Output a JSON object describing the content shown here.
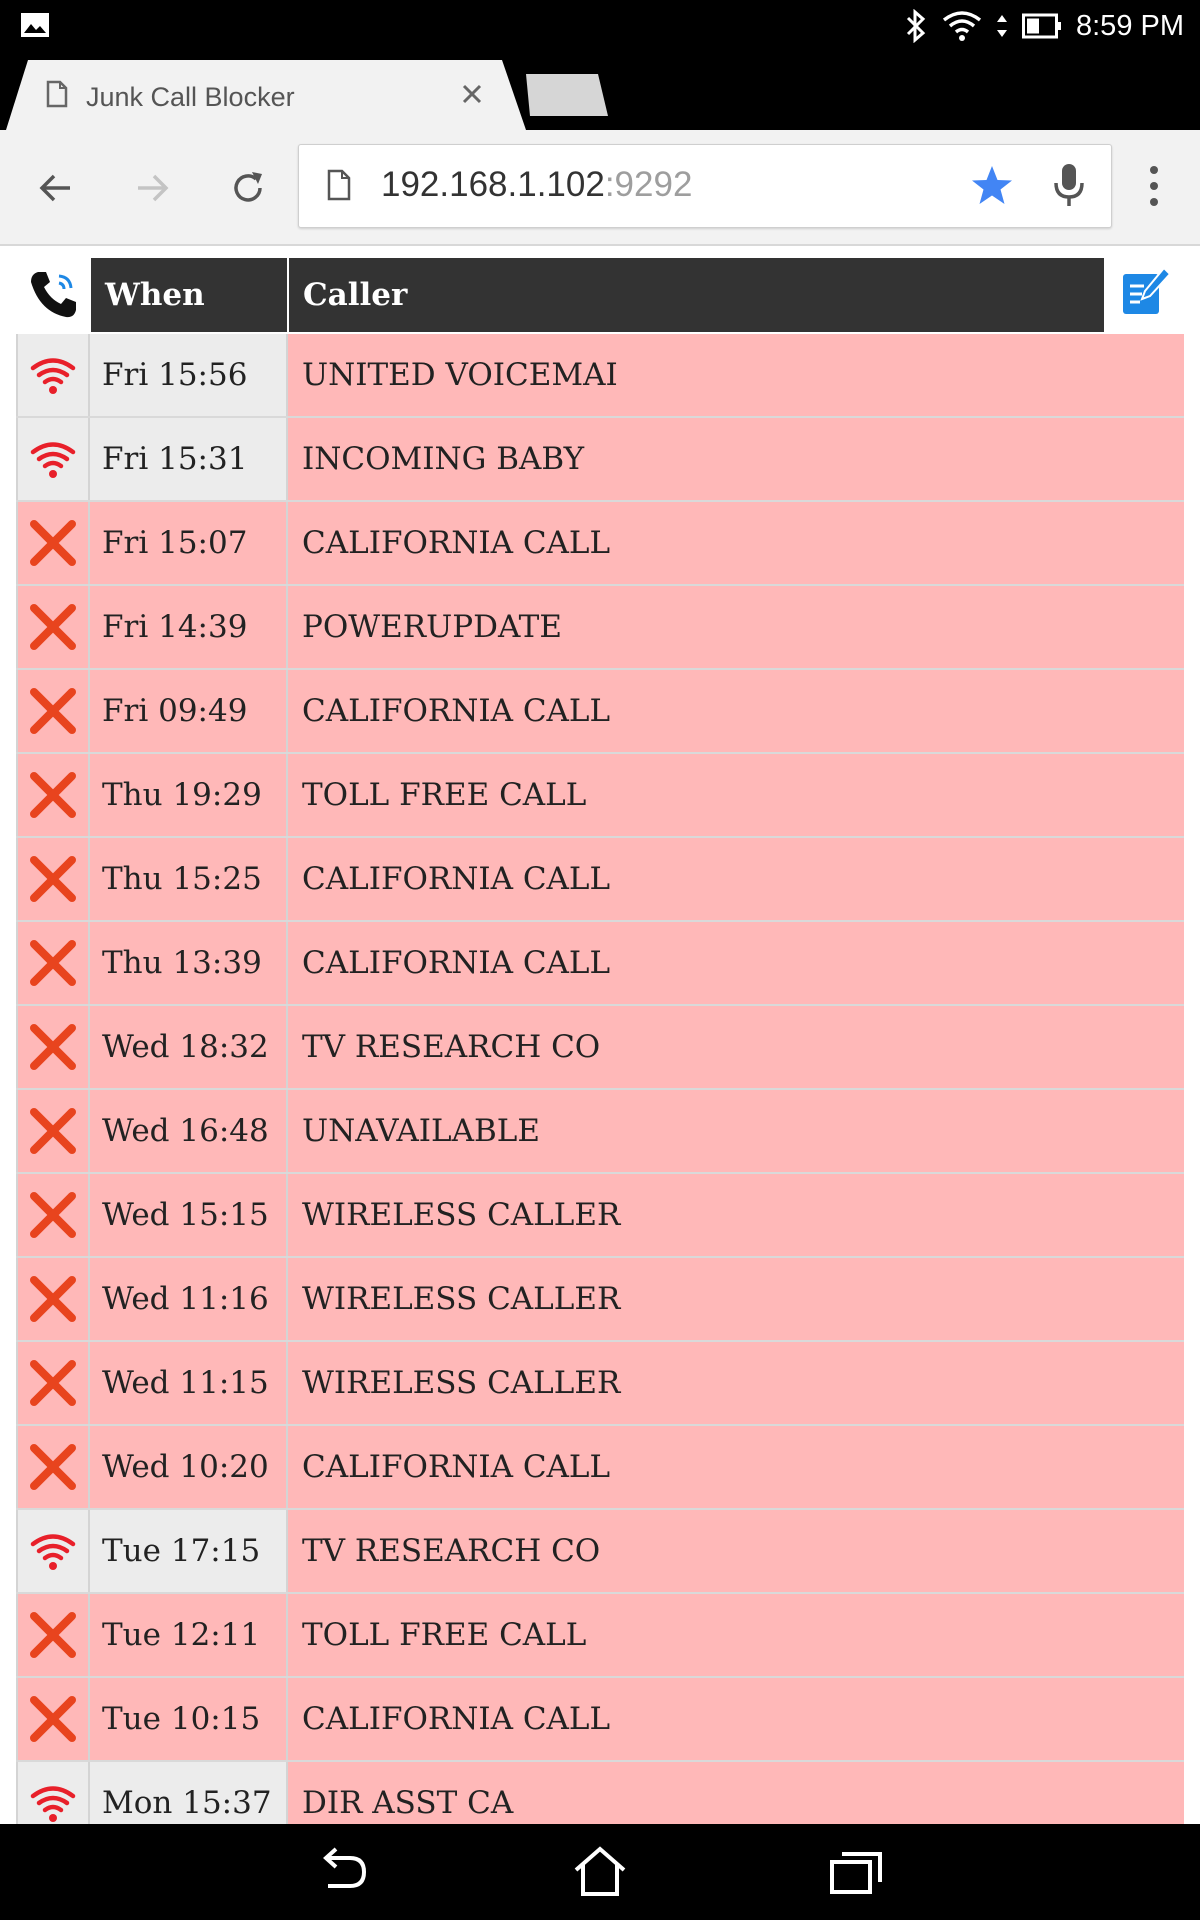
{
  "status_bar": {
    "time": "8:59 PM",
    "icons": [
      "image-notification-icon",
      "bluetooth-icon",
      "wifi-icon",
      "battery-icon"
    ]
  },
  "browser": {
    "tab_title": "Junk Call Blocker",
    "url_host": "192.168.1.102",
    "url_port": ":9292",
    "bookmarked": true
  },
  "table": {
    "headers": {
      "when": "When",
      "caller": "Caller"
    },
    "rows": [
      {
        "status": "allowed",
        "icon": "wifi-icon",
        "when": "Fri 15:56",
        "caller": "UNITED VOICEMAI"
      },
      {
        "status": "allowed",
        "icon": "wifi-icon",
        "when": "Fri 15:31",
        "caller": "INCOMING BABY"
      },
      {
        "status": "blocked",
        "icon": "x-icon",
        "when": "Fri 15:07",
        "caller": "CALIFORNIA CALL"
      },
      {
        "status": "blocked",
        "icon": "x-icon",
        "when": "Fri 14:39",
        "caller": "POWERUPDATE"
      },
      {
        "status": "blocked",
        "icon": "x-icon",
        "when": "Fri 09:49",
        "caller": "CALIFORNIA CALL"
      },
      {
        "status": "blocked",
        "icon": "x-icon",
        "when": "Thu 19:29",
        "caller": "TOLL FREE CALL"
      },
      {
        "status": "blocked",
        "icon": "x-icon",
        "when": "Thu 15:25",
        "caller": "CALIFORNIA CALL"
      },
      {
        "status": "blocked",
        "icon": "x-icon",
        "when": "Thu 13:39",
        "caller": "CALIFORNIA CALL"
      },
      {
        "status": "blocked",
        "icon": "x-icon",
        "when": "Wed 18:32",
        "caller": "TV RESEARCH CO"
      },
      {
        "status": "blocked",
        "icon": "x-icon",
        "when": "Wed 16:48",
        "caller": "UNAVAILABLE"
      },
      {
        "status": "blocked",
        "icon": "x-icon",
        "when": "Wed 15:15",
        "caller": "WIRELESS CALLER"
      },
      {
        "status": "blocked",
        "icon": "x-icon",
        "when": "Wed 11:16",
        "caller": "WIRELESS CALLER"
      },
      {
        "status": "blocked",
        "icon": "x-icon",
        "when": "Wed 11:15",
        "caller": "WIRELESS CALLER"
      },
      {
        "status": "blocked",
        "icon": "x-icon",
        "when": "Wed 10:20",
        "caller": "CALIFORNIA CALL"
      },
      {
        "status": "allowed",
        "icon": "wifi-icon",
        "when": "Tue 17:15",
        "caller": "TV RESEARCH CO"
      },
      {
        "status": "blocked",
        "icon": "x-icon",
        "when": "Tue 12:11",
        "caller": "TOLL FREE CALL"
      },
      {
        "status": "blocked",
        "icon": "x-icon",
        "when": "Tue 10:15",
        "caller": "CALIFORNIA CALL"
      },
      {
        "status": "allowed",
        "icon": "wifi-icon",
        "when": "Mon 15:37",
        "caller": "DIR ASST CA"
      }
    ]
  },
  "colors": {
    "blocked_row": "#ffb8b8",
    "allowed_cell": "#ececec",
    "header_bg": "#333333",
    "x_icon": "#e8441e",
    "wifi_icon": "#e8202a",
    "accent_blue": "#4285f4"
  }
}
